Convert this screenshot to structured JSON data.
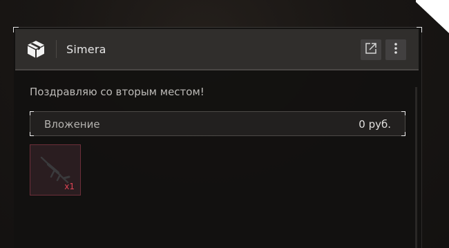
{
  "window": {
    "title": "Simera"
  },
  "header": {
    "icon": "box-icon",
    "open_icon": "external-link-icon",
    "menu_icon": "more-vertical-icon"
  },
  "main": {
    "message": "Поздравляю со вторым местом!",
    "investment": {
      "label": "Вложение",
      "value": "0 руб."
    },
    "items": [
      {
        "icon": "rifle-icon",
        "quantity": "x1"
      }
    ]
  },
  "colors": {
    "accent_item_border": "#6e2f3a",
    "quantity_text": "#e04455",
    "header_bg": "#302e2c"
  }
}
